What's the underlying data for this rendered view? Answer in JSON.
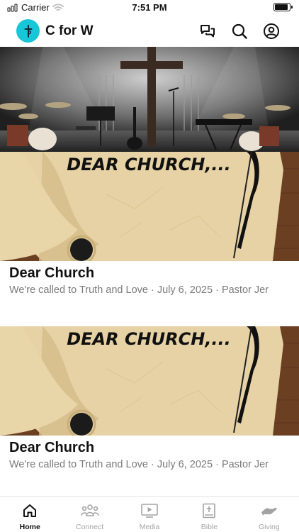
{
  "status_bar": {
    "carrier": "Carrier",
    "time": "7:51 PM"
  },
  "header": {
    "title": "C for W",
    "logo_color": "#17c6d7",
    "icons": [
      "chat-bubbles-icon",
      "search-icon",
      "account-icon"
    ]
  },
  "feed": {
    "posts": [
      {
        "title": "Dear Church",
        "subtitle": "We're called to Truth and Love",
        "date": "July 6, 2025",
        "author": "Pastor Jer",
        "image_caption": "DEAR CHURCH,..."
      },
      {
        "title": "Dear Church",
        "subtitle": "We're called to Truth and Love",
        "date": "July 6, 2025",
        "author": "Pastor Jer",
        "image_caption": "DEAR CHURCH,..."
      }
    ]
  },
  "tabs": [
    {
      "label": "Home",
      "icon": "home-icon",
      "active": true
    },
    {
      "label": "Connect",
      "icon": "people-icon",
      "active": false
    },
    {
      "label": "Media",
      "icon": "play-video-icon",
      "active": false
    },
    {
      "label": "Bible",
      "icon": "bible-icon",
      "active": false
    },
    {
      "label": "Giving",
      "icon": "giving-hand-icon",
      "active": false
    }
  ]
}
